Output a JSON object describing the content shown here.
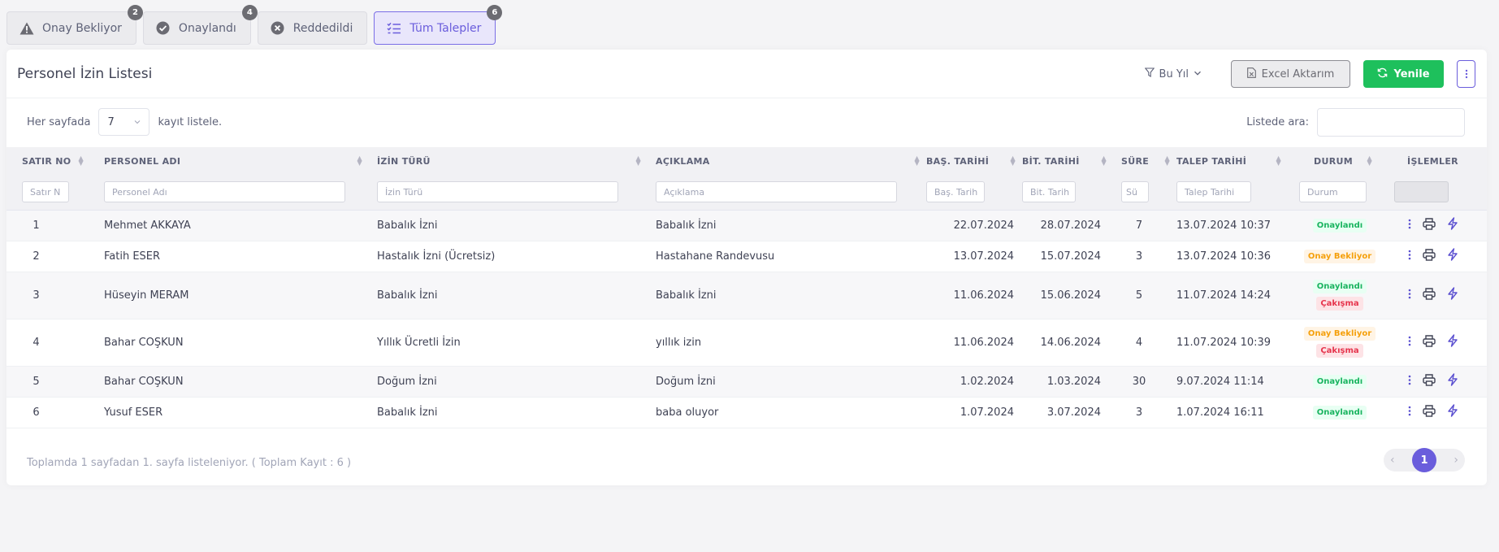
{
  "tabs": [
    {
      "label": "Onay Bekliyor",
      "count": "2",
      "icon": "warning-icon"
    },
    {
      "label": "Onaylandı",
      "count": "4",
      "icon": "check-circle-icon"
    },
    {
      "label": "Reddedildi",
      "count": "",
      "icon": "x-circle-icon"
    },
    {
      "label": "Tüm Talepler",
      "count": "6",
      "icon": "list-check-icon"
    }
  ],
  "header": {
    "title": "Personel İzin Listesi",
    "filter_label": "Bu Yıl",
    "excel_label": "Excel Aktarım",
    "refresh_label": "Yenile"
  },
  "toolbar": {
    "per_page_prefix": "Her sayfada",
    "per_page_value": "7",
    "per_page_suffix": "kayıt listele.",
    "search_label": "Listede ara:"
  },
  "columns": [
    {
      "label": "SATIR NO",
      "placeholder": "Satır N"
    },
    {
      "label": "PERSONEL ADI",
      "placeholder": "Personel Adı"
    },
    {
      "label": "İZİN TÜRÜ",
      "placeholder": "İzin Türü"
    },
    {
      "label": "AÇIKLAMA",
      "placeholder": "Açıklama"
    },
    {
      "label": "BAŞ. TARİHİ",
      "placeholder": "Baş. Tarih"
    },
    {
      "label": "BİT. TARİHİ",
      "placeholder": "Bit. Tarih"
    },
    {
      "label": "SÜRE",
      "placeholder": "Sü"
    },
    {
      "label": "TALEP TARİHİ",
      "placeholder": "Talep Tarihi"
    },
    {
      "label": "DURUM",
      "placeholder": "Durum"
    },
    {
      "label": "İŞLEMLER",
      "placeholder": ""
    }
  ],
  "rows": [
    {
      "no": "1",
      "name": "Mehmet AKKAYA",
      "type": "Babalık İzni",
      "desc": "Babalık İzni",
      "start": "22.07.2024",
      "end": "28.07.2024",
      "days": "7",
      "requested": "13.07.2024 10:37",
      "status": [
        {
          "label": "Onaylandı",
          "color": "green"
        }
      ]
    },
    {
      "no": "2",
      "name": "Fatih ESER",
      "type": "Hastalık İzni (Ücretsiz)",
      "desc": "Hastahane Randevusu",
      "start": "13.07.2024",
      "end": "15.07.2024",
      "days": "3",
      "requested": "13.07.2024 10:36",
      "status": [
        {
          "label": "Onay Bekliyor",
          "color": "orange"
        }
      ]
    },
    {
      "no": "3",
      "name": "Hüseyin MERAM",
      "type": "Babalık İzni",
      "desc": "Babalık İzni",
      "start": "11.06.2024",
      "end": "15.06.2024",
      "days": "5",
      "requested": "11.07.2024 14:24",
      "status": [
        {
          "label": "Onaylandı",
          "color": "green"
        },
        {
          "label": "Çakışma",
          "color": "red"
        }
      ]
    },
    {
      "no": "4",
      "name": "Bahar COŞKUN",
      "type": "Yıllık Ücretli İzin",
      "desc": "yıllık izin",
      "start": "11.06.2024",
      "end": "14.06.2024",
      "days": "4",
      "requested": "11.07.2024 10:39",
      "status": [
        {
          "label": "Onay Bekliyor",
          "color": "orange"
        },
        {
          "label": "Çakışma",
          "color": "red"
        }
      ]
    },
    {
      "no": "5",
      "name": "Bahar COŞKUN",
      "type": "Doğum İzni",
      "desc": "Doğum İzni",
      "start": "1.02.2024",
      "end": "1.03.2024",
      "days": "30",
      "requested": "9.07.2024 11:14",
      "status": [
        {
          "label": "Onaylandı",
          "color": "green"
        }
      ]
    },
    {
      "no": "6",
      "name": "Yusuf ESER",
      "type": "Babalık İzni",
      "desc": "baba oluyor",
      "start": "1.07.2024",
      "end": "3.07.2024",
      "days": "3",
      "requested": "1.07.2024 16:11",
      "status": [
        {
          "label": "Onaylandı",
          "color": "green"
        }
      ]
    }
  ],
  "footer": {
    "summary": "Toplamda 1 sayfadan 1. sayfa listeleniyor. ( Toplam Kayıt : 6 )",
    "current_page": "1"
  },
  "colors": {
    "accent": "#6a5ddc",
    "success": "#1ec05c",
    "warning": "#f5a00c",
    "danger": "#e6354d"
  }
}
